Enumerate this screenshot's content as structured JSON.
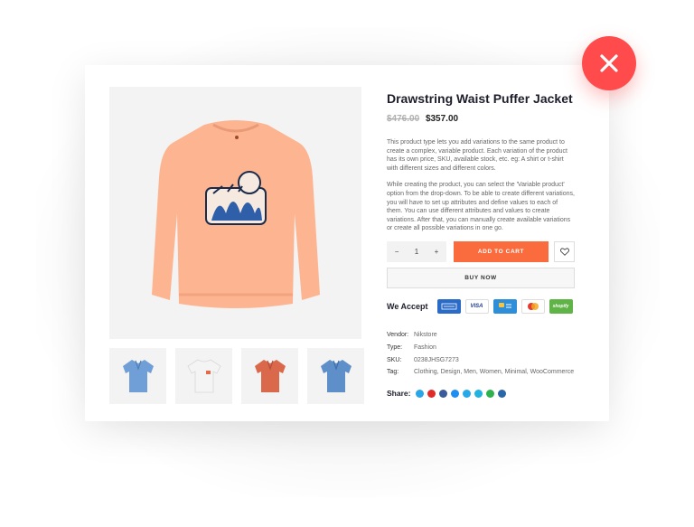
{
  "product": {
    "title": "Drawstring Waist Puffer Jacket",
    "old_price": "$476.00",
    "new_price": "$357.00",
    "description": [
      "This product type lets you add variations to the same product to create a complex, variable product. Each variation of the product has its own price, SKU, available stock, etc. eg: A shirt or t-shirt with different sizes and different colors.",
      "While creating the product, you can select the 'Variable product' option from the drop-down. To be able to create different variations, you will have to set up attributes and define values to each of them. You can use different attributes and values to create variations. After that, you can manually create available variations or create all possible variations in one go."
    ],
    "main_image_color": "#fdb491",
    "thumbnails": [
      {
        "icon": "blue-polo-shirt-icon",
        "color": "#6f9fd6"
      },
      {
        "icon": "white-tshirt-icon",
        "color": "#f4f4f4"
      },
      {
        "icon": "orange-polo-shirt-icon",
        "color": "#d9694a"
      },
      {
        "icon": "blue-polo-shirt-icon",
        "color": "#5f8fc8"
      }
    ]
  },
  "cart": {
    "minus": "−",
    "quantity": "1",
    "plus": "+",
    "add_to_cart_label": "ADD TO CART",
    "buy_now_label": "BUY NOW",
    "accent_color": "#fa6c3e"
  },
  "payment": {
    "label": "We Accept",
    "methods": [
      "amex",
      "visa",
      "cb",
      "mastercard",
      "shopify"
    ],
    "visa_text": "VISA",
    "shopify_text": "shopify"
  },
  "meta": [
    {
      "key": "Vendor:",
      "value": "Nikstore"
    },
    {
      "key": "Type:",
      "value": "Fashion"
    },
    {
      "key": "SKU:",
      "value": "0238JHSG7273"
    },
    {
      "key": "Tag:",
      "value": "Clothing, Design, Men, Women, Minimal, WooCommerce"
    }
  ],
  "share": {
    "label": "Share:",
    "networks": [
      {
        "icon": "skype-icon",
        "color": "#2aa5e6"
      },
      {
        "icon": "pinterest-icon",
        "color": "#e02b2b"
      },
      {
        "icon": "facebook-icon",
        "color": "#3b5b9b"
      },
      {
        "icon": "messenger-icon",
        "color": "#1f8ef1"
      },
      {
        "icon": "twitter-icon",
        "color": "#29a8e8"
      },
      {
        "icon": "vimeo-icon",
        "color": "#20b3e0"
      },
      {
        "icon": "whatsapp-icon",
        "color": "#2fb24e"
      },
      {
        "icon": "linkedin-icon",
        "color": "#2a67a8"
      }
    ]
  },
  "close_button_color": "#ff4b4b"
}
